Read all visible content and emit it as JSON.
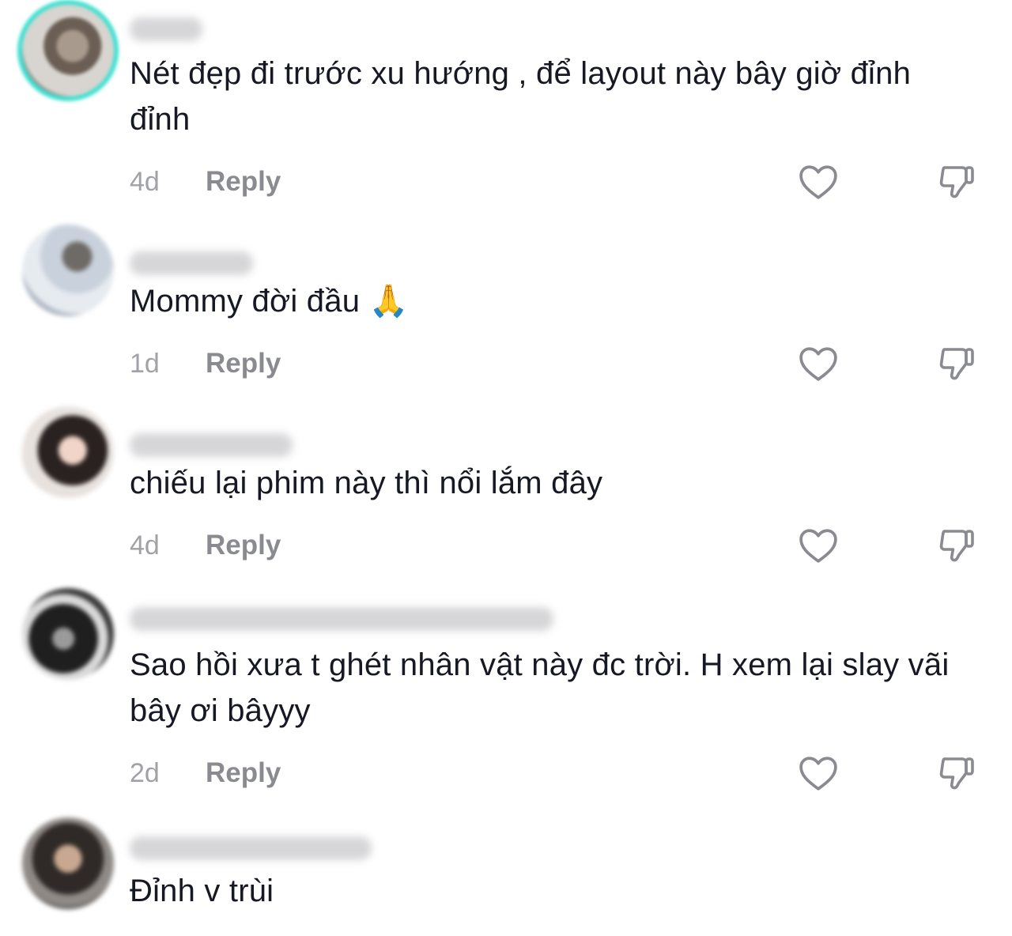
{
  "icons": {
    "like": "heart-outline-icon",
    "dislike": "thumbs-down-outline-icon"
  },
  "colors": {
    "text": "#161823",
    "muted": "#a1a2a7",
    "reply": "#8a8b91",
    "icon": "#8a8b91",
    "avatar_ring": "#3fe0d0"
  },
  "comments": [
    {
      "text": "Nét đẹp đi trước xu hướng , để layout này bây giờ đỉnh đỉnh",
      "time": "4d",
      "reply": "Reply"
    },
    {
      "text": "Mommy đời đầu 🙏",
      "time": "1d",
      "reply": "Reply"
    },
    {
      "text": "chiếu lại phim này thì nổi lắm đây",
      "time": "4d",
      "reply": "Reply"
    },
    {
      "text": "Sao hồi xưa t ghét nhân vật này đc trời. H xem lại slay vãi bây ơi bâyyy",
      "time": "2d",
      "reply": "Reply"
    },
    {
      "text": "Đỉnh v trùi"
    }
  ]
}
